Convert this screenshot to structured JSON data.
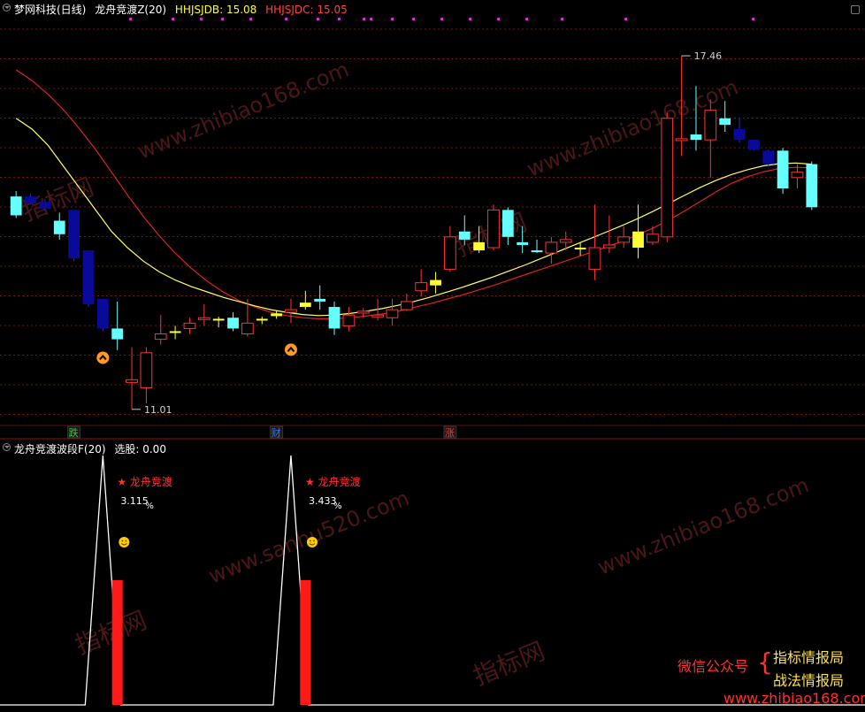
{
  "header": {
    "stock_title": "梦网科技(日线)",
    "indicator_name": "龙舟竞渡Z(20)",
    "hhjsjdb_label": "HHJSJDB: 15.08",
    "hhjsjdc_label": "HHJSJDC: 15.05"
  },
  "sub_header": {
    "indicator_name": "龙舟竞渡波段F(20)",
    "select_label": "选股: 0.00"
  },
  "colors": {
    "up_candle": "#ffff33",
    "down_candle_cyan": "#66ffff",
    "down_candle_navy": "#0a0a9a",
    "hollow_up": "#ff3333",
    "ma_yellow": "#ffff66",
    "ma_red": "#dd2222",
    "grid": "#7a1010",
    "signal_bar": "#ff1a1a"
  },
  "main_chart": {
    "price_max_label": "17.46",
    "price_min_label": "11.01",
    "ylim": [
      10.7,
      18.2
    ],
    "markers": [
      {
        "label": "跌",
        "candle": 4,
        "color": "#33cc33"
      },
      {
        "label": "财",
        "candle": 18,
        "color": "#3377ff"
      },
      {
        "label": "涨",
        "candle": 30,
        "color": "#ff3333"
      }
    ],
    "up_arrows": [
      6,
      19
    ]
  },
  "chart_data": {
    "type": "candlestick",
    "ohlc": [
      {
        "o": 14.85,
        "h": 14.95,
        "l": 14.45,
        "c": 14.5,
        "style": "cyan"
      },
      {
        "o": 14.85,
        "h": 14.9,
        "l": 14.7,
        "c": 14.72,
        "style": "navy"
      },
      {
        "o": 14.75,
        "h": 14.8,
        "l": 14.6,
        "c": 14.62,
        "style": "navy"
      },
      {
        "o": 14.4,
        "h": 14.55,
        "l": 14.05,
        "c": 14.15,
        "style": "cyan"
      },
      {
        "o": 14.6,
        "h": 14.6,
        "l": 13.65,
        "c": 13.7,
        "style": "navy"
      },
      {
        "o": 13.85,
        "h": 13.85,
        "l": 12.8,
        "c": 12.85,
        "style": "navy"
      },
      {
        "o": 12.95,
        "h": 12.95,
        "l": 12.35,
        "c": 12.4,
        "style": "navy"
      },
      {
        "o": 12.4,
        "h": 12.9,
        "l": 12.0,
        "c": 12.2,
        "style": "cyan"
      },
      {
        "o": 11.45,
        "h": 12.05,
        "l": 10.9,
        "c": 11.4,
        "style": "hollow_flat"
      },
      {
        "o": 11.3,
        "h": 12.05,
        "l": 11.01,
        "c": 11.95,
        "style": "hollow"
      },
      {
        "o": 12.2,
        "h": 12.65,
        "l": 12.1,
        "c": 12.3,
        "style": "hollow"
      },
      {
        "o": 12.35,
        "h": 12.45,
        "l": 12.2,
        "c": 12.35,
        "style": "yellow"
      },
      {
        "o": 12.4,
        "h": 12.6,
        "l": 12.3,
        "c": 12.5,
        "style": "hollow"
      },
      {
        "o": 12.6,
        "h": 12.85,
        "l": 12.45,
        "c": 12.6,
        "style": "hollow_flat"
      },
      {
        "o": 12.58,
        "h": 12.62,
        "l": 12.42,
        "c": 12.55,
        "style": "yellow"
      },
      {
        "o": 12.6,
        "h": 12.7,
        "l": 12.35,
        "c": 12.4,
        "style": "cyan"
      },
      {
        "o": 12.5,
        "h": 12.95,
        "l": 12.25,
        "c": 12.3,
        "style": "hollow"
      },
      {
        "o": 12.55,
        "h": 12.62,
        "l": 12.48,
        "c": 12.58,
        "style": "yellow"
      },
      {
        "o": 12.63,
        "h": 12.73,
        "l": 12.58,
        "c": 12.68,
        "style": "yellow"
      },
      {
        "o": 12.7,
        "h": 12.95,
        "l": 12.5,
        "c": 12.75,
        "style": "hollow"
      },
      {
        "o": 12.8,
        "h": 13.1,
        "l": 12.75,
        "c": 12.88,
        "style": "yellow"
      },
      {
        "o": 12.95,
        "h": 13.2,
        "l": 12.75,
        "c": 12.9,
        "style": "cyan"
      },
      {
        "o": 12.8,
        "h": 12.9,
        "l": 12.28,
        "c": 12.4,
        "style": "cyan"
      },
      {
        "o": 12.45,
        "h": 12.8,
        "l": 12.35,
        "c": 12.65,
        "style": "hollow"
      },
      {
        "o": 12.72,
        "h": 12.78,
        "l": 12.6,
        "c": 12.72,
        "style": "hollow_flat"
      },
      {
        "o": 12.65,
        "h": 12.95,
        "l": 12.55,
        "c": 12.65,
        "style": "hollow_flat"
      },
      {
        "o": 12.6,
        "h": 12.95,
        "l": 12.45,
        "c": 12.75,
        "style": "hollow"
      },
      {
        "o": 12.75,
        "h": 13.05,
        "l": 12.72,
        "c": 12.9,
        "style": "hollow"
      },
      {
        "o": 13.1,
        "h": 13.5,
        "l": 13.0,
        "c": 13.25,
        "style": "hollow"
      },
      {
        "o": 13.2,
        "h": 13.45,
        "l": 13.05,
        "c": 13.3,
        "style": "yellow"
      },
      {
        "o": 13.5,
        "h": 14.3,
        "l": 13.45,
        "c": 14.1,
        "style": "hollow"
      },
      {
        "o": 14.2,
        "h": 14.5,
        "l": 13.95,
        "c": 14.05,
        "style": "cyan"
      },
      {
        "o": 14.0,
        "h": 14.3,
        "l": 13.8,
        "c": 13.85,
        "style": "yellow"
      },
      {
        "o": 13.9,
        "h": 14.7,
        "l": 13.85,
        "c": 14.6,
        "style": "hollow"
      },
      {
        "o": 14.6,
        "h": 14.65,
        "l": 13.95,
        "c": 14.1,
        "style": "cyan"
      },
      {
        "o": 13.95,
        "h": 14.3,
        "l": 13.8,
        "c": 14.0,
        "style": "cyan"
      },
      {
        "o": 13.85,
        "h": 14.05,
        "l": 13.8,
        "c": 13.85,
        "style": "cyan"
      },
      {
        "o": 13.8,
        "h": 14.1,
        "l": 13.6,
        "c": 14.0,
        "style": "hollow"
      },
      {
        "o": 14.0,
        "h": 14.2,
        "l": 13.85,
        "c": 14.05,
        "style": "hollow"
      },
      {
        "o": 13.9,
        "h": 14.0,
        "l": 13.75,
        "c": 13.9,
        "style": "yellow"
      },
      {
        "o": 13.9,
        "h": 14.7,
        "l": 13.3,
        "c": 13.5,
        "style": "hollow"
      },
      {
        "o": 13.9,
        "h": 14.5,
        "l": 13.8,
        "c": 13.95,
        "style": "hollow_flat"
      },
      {
        "o": 14.0,
        "h": 14.3,
        "l": 13.9,
        "c": 14.1,
        "style": "hollow_flat"
      },
      {
        "o": 13.9,
        "h": 14.7,
        "l": 13.7,
        "c": 14.2,
        "style": "yellow"
      },
      {
        "o": 14.0,
        "h": 14.3,
        "l": 13.95,
        "c": 14.15,
        "style": "hollow_flat"
      },
      {
        "o": 14.1,
        "h": 16.4,
        "l": 14.0,
        "c": 16.3,
        "style": "hollow"
      },
      {
        "o": 15.9,
        "h": 17.46,
        "l": 15.6,
        "c": 15.92,
        "style": "hollow_flat"
      },
      {
        "o": 16.0,
        "h": 16.9,
        "l": 15.7,
        "c": 15.9,
        "style": "cyan"
      },
      {
        "o": 15.9,
        "h": 16.65,
        "l": 15.2,
        "c": 16.45,
        "style": "hollow"
      },
      {
        "o": 16.3,
        "h": 16.62,
        "l": 16.05,
        "c": 16.18,
        "style": "cyan"
      },
      {
        "o": 16.1,
        "h": 16.3,
        "l": 15.85,
        "c": 15.9,
        "style": "navy"
      },
      {
        "o": 15.9,
        "h": 15.9,
        "l": 15.7,
        "c": 15.72,
        "style": "navy"
      },
      {
        "o": 15.7,
        "h": 15.72,
        "l": 15.4,
        "c": 15.45,
        "style": "navy"
      },
      {
        "o": 15.7,
        "h": 15.75,
        "l": 14.9,
        "c": 15.0,
        "style": "cyan"
      },
      {
        "o": 15.2,
        "h": 15.45,
        "l": 15.0,
        "c": 15.3,
        "style": "hollow"
      },
      {
        "o": 15.45,
        "h": 15.5,
        "l": 14.6,
        "c": 14.65,
        "style": "cyan"
      }
    ],
    "ma_yellow": [
      16.3,
      16.1,
      15.8,
      15.4,
      15.0,
      14.6,
      14.2,
      13.9,
      13.65,
      13.45,
      13.3,
      13.18,
      13.08,
      12.98,
      12.9,
      12.82,
      12.75,
      12.7,
      12.66,
      12.64,
      12.65,
      12.68,
      12.72,
      12.77,
      12.83,
      12.9,
      12.98,
      13.07,
      13.16,
      13.26,
      13.36,
      13.47,
      13.58,
      13.7,
      13.82,
      13.94,
      14.06,
      14.18,
      14.3,
      14.43,
      14.57,
      14.72,
      14.87,
      15.02,
      15.15,
      15.26,
      15.35,
      15.42,
      15.46,
      15.47,
      15.45
    ],
    "ma_red": [
      17.2,
      17.0,
      16.75,
      16.45,
      16.1,
      15.72,
      15.3,
      14.88,
      14.48,
      14.12,
      13.8,
      13.52,
      13.28,
      13.08,
      12.92,
      12.8,
      12.7,
      12.64,
      12.6,
      12.58,
      12.58,
      12.6,
      12.63,
      12.67,
      12.72,
      12.79,
      12.86,
      12.94,
      13.02,
      13.11,
      13.2,
      13.3,
      13.4,
      13.5,
      13.6,
      13.7,
      13.8,
      13.9,
      14.01,
      14.13,
      14.26,
      14.41,
      14.58,
      14.76,
      14.94,
      15.1,
      15.22,
      15.31,
      15.37,
      15.39,
      15.38
    ],
    "signal_peaks": [
      {
        "x_index": 6,
        "label": "★ 龙舟竞渡",
        "value": "3.115",
        "unit": "%"
      },
      {
        "x_index": 19,
        "label": "★ 龙舟竞渡",
        "value": "3.433",
        "unit": "%"
      }
    ],
    "signal_bar_index": [
      7,
      20
    ]
  },
  "watermark": {
    "line1_left": "微信公众号",
    "line1_right": "指标情报局",
    "line2_right": "战法情报局",
    "site": "www.zhibiao168.com",
    "site2": "www.sanhu520.com",
    "brand": "指标网"
  }
}
